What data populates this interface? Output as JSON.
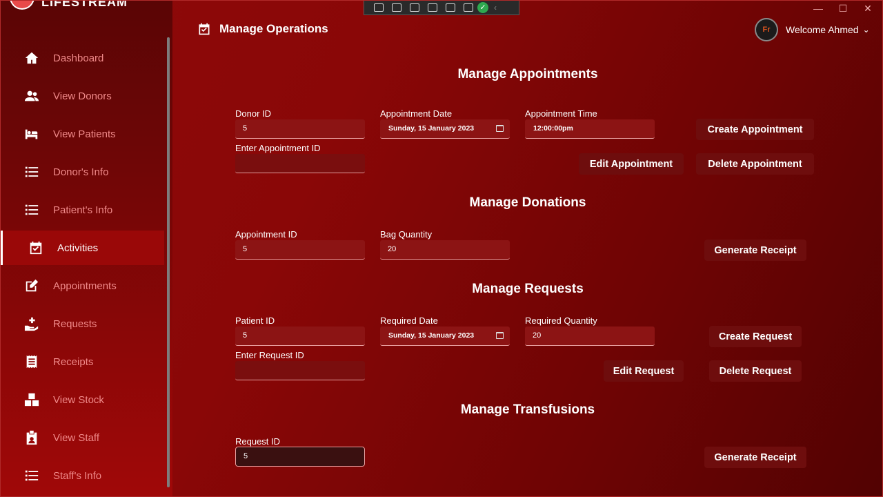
{
  "app": {
    "name": "LIFESTREAM"
  },
  "nav": [
    {
      "label": "Dashboard",
      "icon": "home-icon"
    },
    {
      "label": "View Donors",
      "icon": "users-icon"
    },
    {
      "label": "View Patients",
      "icon": "bed-icon"
    },
    {
      "label": "Donor's Info",
      "icon": "list-icon"
    },
    {
      "label": "Patient's Info",
      "icon": "list-icon"
    },
    {
      "label": "Activities",
      "icon": "calendar-check-icon"
    },
    {
      "label": "Appointments",
      "icon": "edit-icon"
    },
    {
      "label": "Requests",
      "icon": "hand-plus-icon"
    },
    {
      "label": "Receipts",
      "icon": "receipt-icon"
    },
    {
      "label": "View Stock",
      "icon": "boxes-icon"
    },
    {
      "label": "View Staff",
      "icon": "badge-icon"
    },
    {
      "label": "Staff's Info",
      "icon": "list-icon"
    }
  ],
  "active_nav": "Activities",
  "header": {
    "title": "Manage Operations",
    "welcome": "Welcome Ahmed"
  },
  "appointments": {
    "title": "Manage Appointments",
    "donor_id_label": "Donor ID",
    "donor_id": "5",
    "date_label": "Appointment Date",
    "date": "Sunday, 15 January 2023",
    "time_label": "Appointment Time",
    "time": "12:00:00pm",
    "appt_id_label": "Enter Appointment ID",
    "appt_id": "",
    "create": "Create Appointment",
    "edit": "Edit Appointment",
    "delete": "Delete Appointment"
  },
  "donations": {
    "title": "Manage Donations",
    "appt_id_label": "Appointment ID",
    "appt_id": "5",
    "bag_label": "Bag Quantity",
    "bag": "20",
    "generate": "Generate Receipt"
  },
  "requests": {
    "title": "Manage Requests",
    "patient_label": "Patient ID",
    "patient": "5",
    "date_label": "Required Date",
    "date": "Sunday, 15 January 2023",
    "qty_label": "Required Quantity",
    "qty": "20",
    "req_id_label": "Enter Request ID",
    "req_id": "",
    "create": "Create Request",
    "edit": "Edit Request",
    "delete": "Delete Request"
  },
  "transfusions": {
    "title": "Manage Transfusions",
    "req_id_label": "Request ID",
    "req_id": "5",
    "generate": "Generate Receipt"
  },
  "colors": {
    "accent": "#8e0a0a",
    "sidebar": "#6d0606",
    "button": "#6e0d0d"
  }
}
